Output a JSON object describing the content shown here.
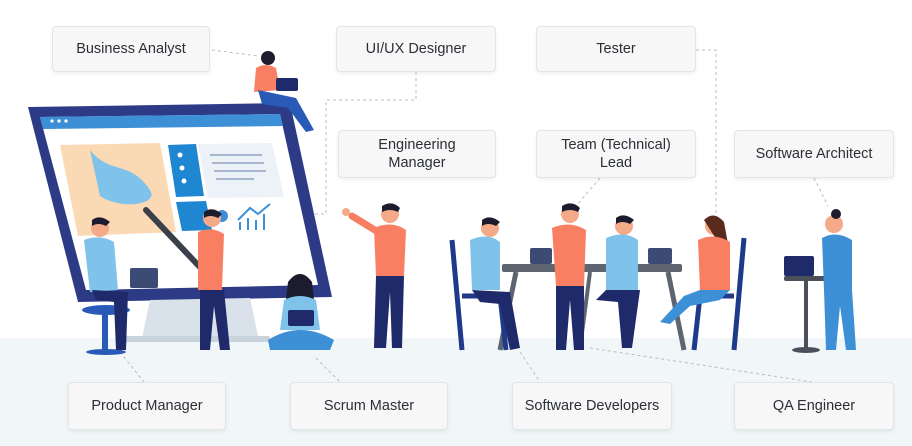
{
  "roles": {
    "business_analyst": "Business Analyst",
    "ui_ux_designer": "UI/UX Designer",
    "tester": "Tester",
    "engineering_manager": "Engineering\nManager",
    "team_lead": "Team (Technical)\nLead",
    "software_architect": "Software Architect",
    "product_manager": "Product Manager",
    "scrum_master": "Scrum Master",
    "software_developers": "Software Developers",
    "qa_engineer": "QA Engineer"
  },
  "colors": {
    "accent": "#f97f63",
    "primary_blue": "#2a93d5",
    "navy": "#1f2a6b",
    "label_bg": "#f7f7f8"
  }
}
